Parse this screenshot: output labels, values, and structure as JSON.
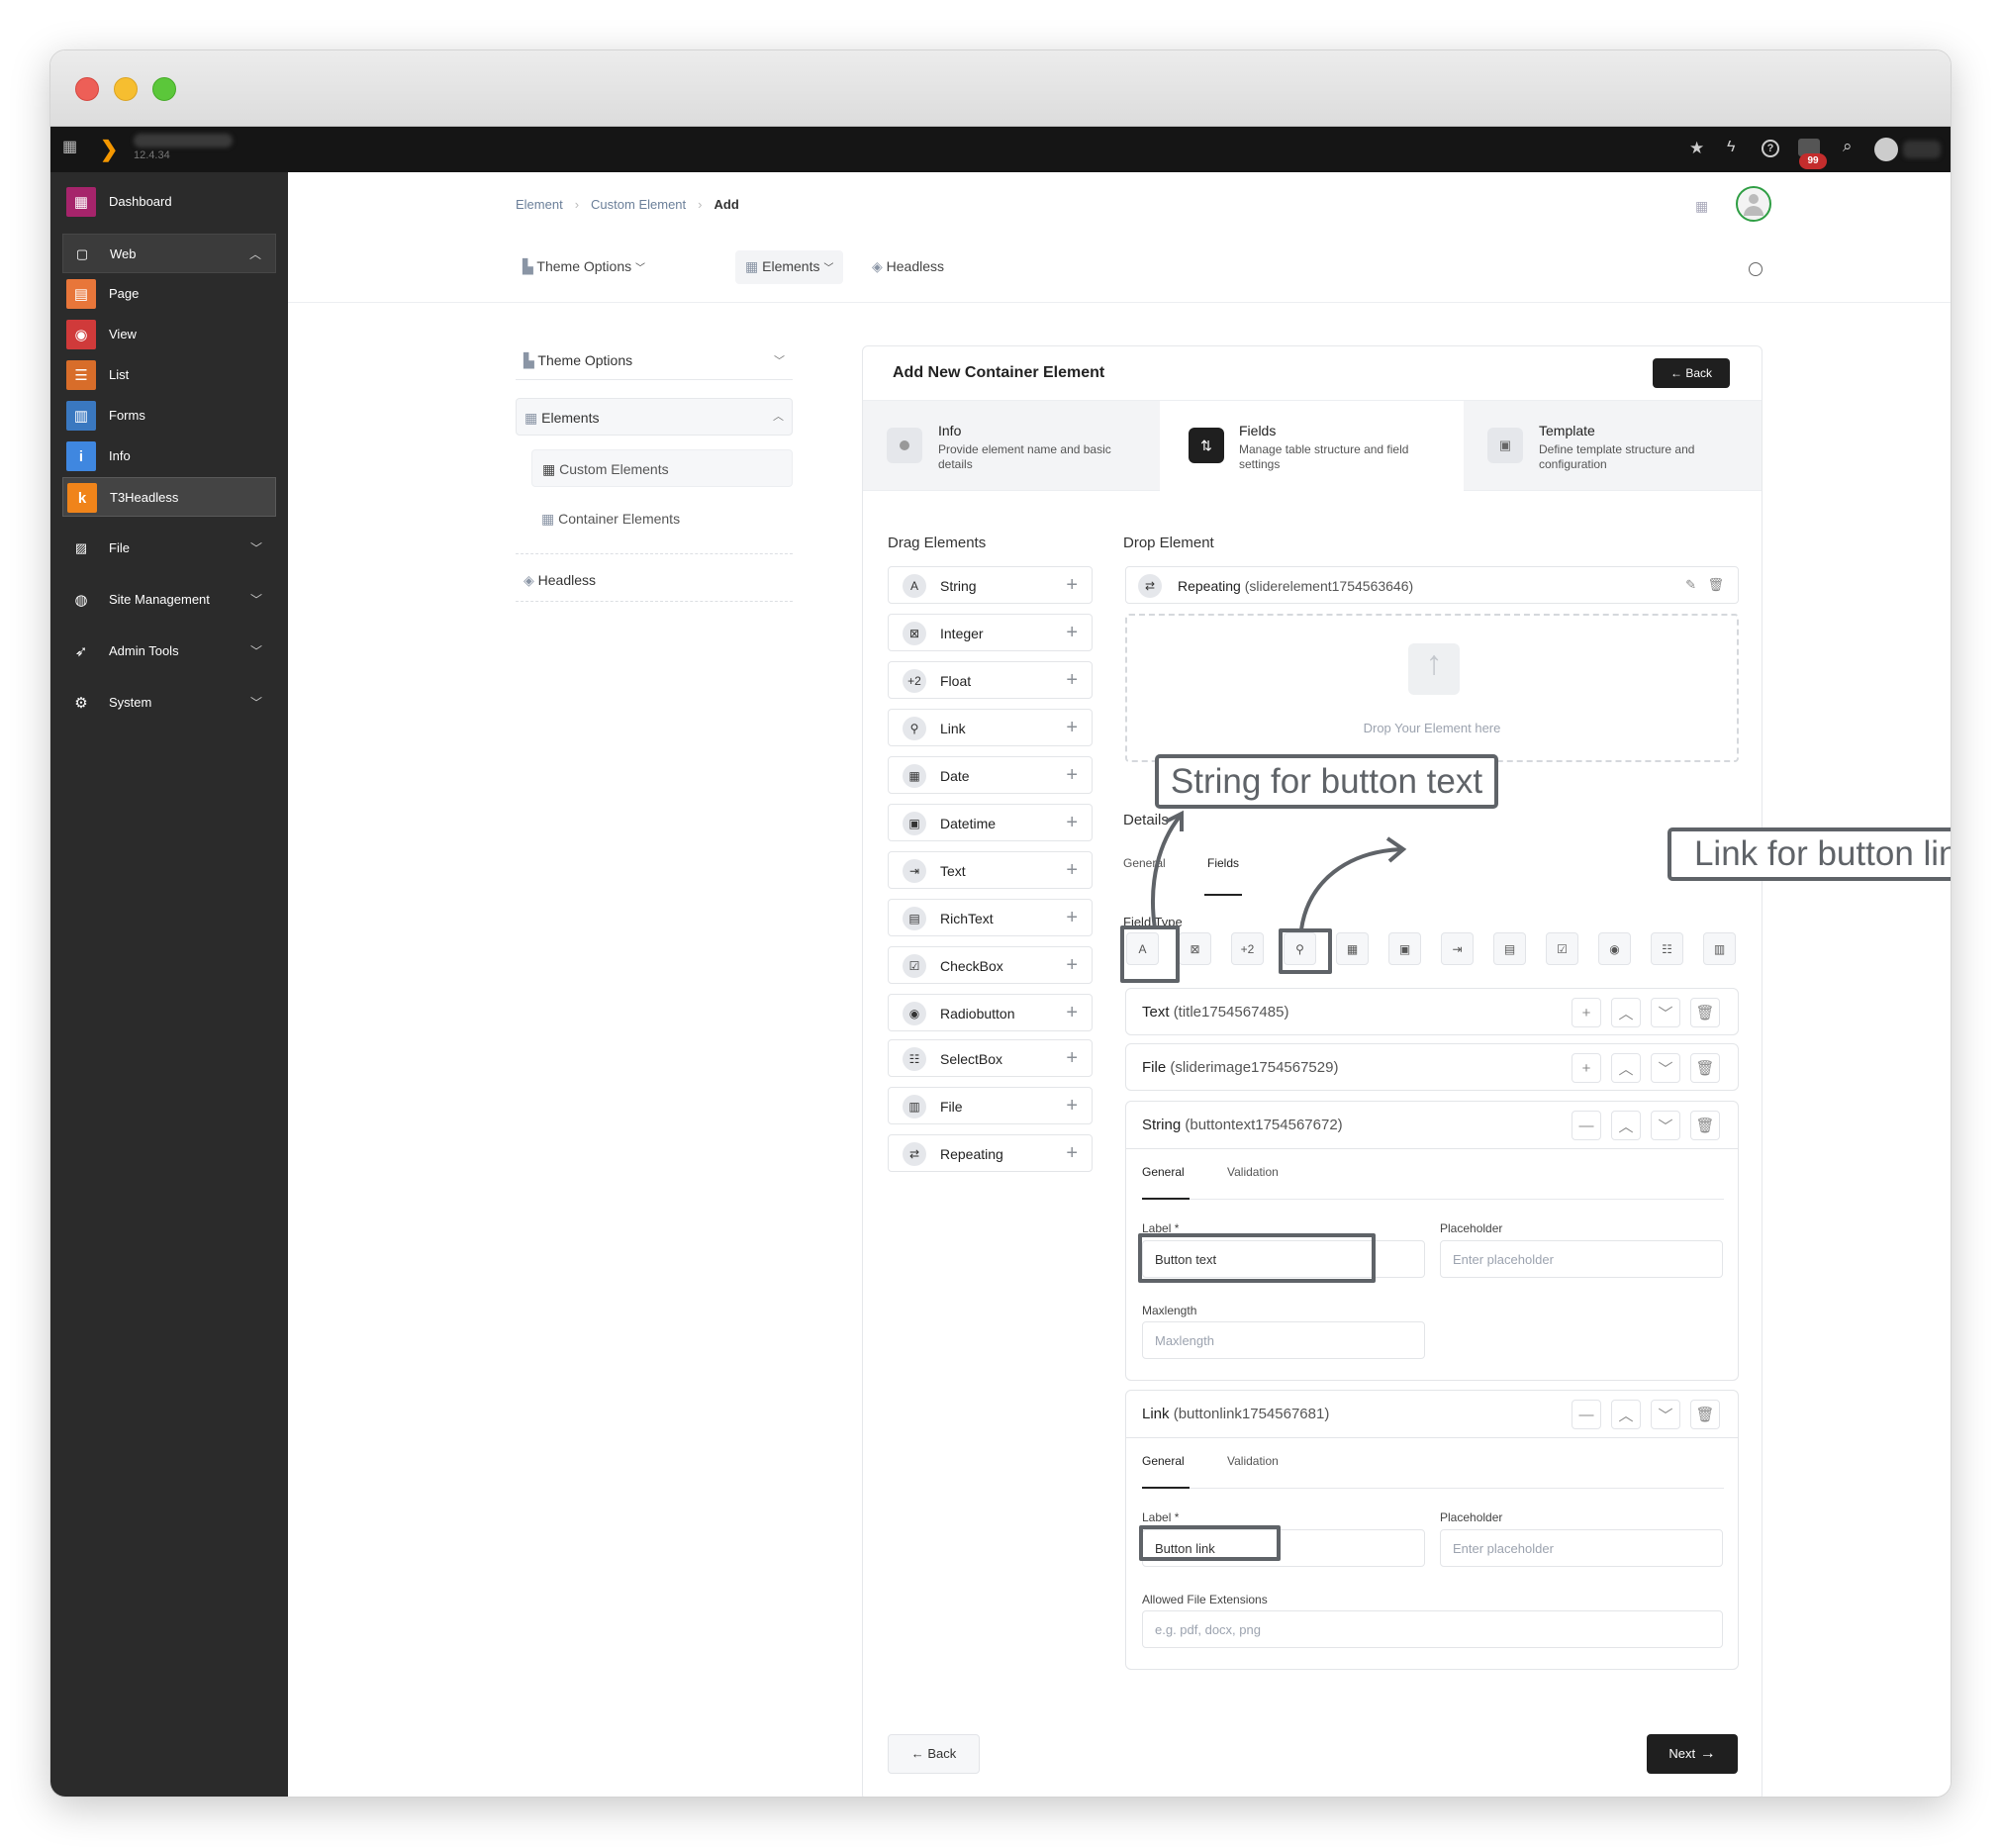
{
  "topbar": {
    "version": "12.4.34",
    "notification_count": "99"
  },
  "sidebar": {
    "items": [
      {
        "label": "Dashboard",
        "icon": "dashboard-icon",
        "color": "#a6246b"
      },
      {
        "label": "Web",
        "icon": "web-icon"
      },
      {
        "label": "Page",
        "icon": "page-icon",
        "color": "#e8763a"
      },
      {
        "label": "View",
        "icon": "view-icon",
        "color": "#d03a3a"
      },
      {
        "label": "List",
        "icon": "list-icon",
        "color": "#d86d2a"
      },
      {
        "label": "Forms",
        "icon": "forms-icon",
        "color": "#3a78c0"
      },
      {
        "label": "Info",
        "icon": "info-icon",
        "color": "#3f87e0"
      },
      {
        "label": "T3Headless",
        "icon": "t3headless-icon",
        "color": "#f0841a"
      },
      {
        "label": "File",
        "icon": "file-icon"
      },
      {
        "label": "Site Management",
        "icon": "site-management-icon"
      },
      {
        "label": "Admin Tools",
        "icon": "admin-tools-icon"
      },
      {
        "label": "System",
        "icon": "system-icon"
      }
    ]
  },
  "breadcrumb": {
    "items": [
      "Element",
      "Custom Element",
      "Add"
    ]
  },
  "modulebar": {
    "theme_options": "Theme Options",
    "elements": "Elements",
    "headless": "Headless"
  },
  "leftnav": {
    "theme_options": "Theme Options",
    "elements": "Elements",
    "custom_elements": "Custom Elements",
    "container_elements": "Container Elements",
    "headless": "Headless"
  },
  "card": {
    "title": "Add New Container Element",
    "back": "Back",
    "steps": [
      {
        "title": "Info",
        "desc": "Provide element name and basic details"
      },
      {
        "title": "Fields",
        "desc": "Manage table structure and field settings"
      },
      {
        "title": "Template",
        "desc": "Define template structure and configuration"
      }
    ],
    "drag_title": "Drag Elements",
    "drop_title": "Drop Element",
    "drag_items": [
      {
        "label": "String",
        "icon": "A"
      },
      {
        "label": "Integer",
        "icon": "⊠"
      },
      {
        "label": "Float",
        "icon": "+2"
      },
      {
        "label": "Link",
        "icon": "⚲"
      },
      {
        "label": "Date",
        "icon": "▦"
      },
      {
        "label": "Datetime",
        "icon": "▣"
      },
      {
        "label": "Text",
        "icon": "⇥"
      },
      {
        "label": "RichText",
        "icon": "▤"
      },
      {
        "label": "CheckBox",
        "icon": "☑"
      },
      {
        "label": "Radiobutton",
        "icon": "◉"
      },
      {
        "label": "SelectBox",
        "icon": "☷"
      },
      {
        "label": "File",
        "icon": "▥"
      },
      {
        "label": "Repeating",
        "icon": "⇄"
      }
    ],
    "repeating_name": "Repeating",
    "repeating_id": "(sliderelement1754563646)",
    "drop_here": "Drop Your Element here",
    "details": "Details",
    "tab_general": "General",
    "tab_fields": "Fields",
    "field_type": "Field Type",
    "field_types": [
      "A",
      "⊠",
      "+2",
      "⚲",
      "▦",
      "▣",
      "⇥",
      "▤",
      "☑",
      "◉",
      "☷",
      "▥"
    ],
    "fields": [
      {
        "type": "Text",
        "id": "(title1754567485)"
      },
      {
        "type": "File",
        "id": "(sliderimage1754567529)"
      },
      {
        "type": "String",
        "id": "(buttontext1754567672)"
      },
      {
        "type": "Link",
        "id": "(buttonlink1754567681)"
      }
    ],
    "sub_general": "General",
    "sub_validation": "Validation",
    "label_label": "Label *",
    "placeholder_label": "Placeholder",
    "placeholder_ph": "Enter placeholder",
    "string_label_value": "Button text",
    "maxlength_label": "Maxlength",
    "maxlength_ph": "Maxlength",
    "link_label_value": "Button link",
    "allowed_ext_label": "Allowed File Extensions",
    "allowed_ext_ph": "e.g. pdf, docx, png",
    "footer_back": "Back",
    "footer_next": "Next"
  },
  "annotations": {
    "string_note": "String for button text",
    "link_note": "Link for button link"
  }
}
